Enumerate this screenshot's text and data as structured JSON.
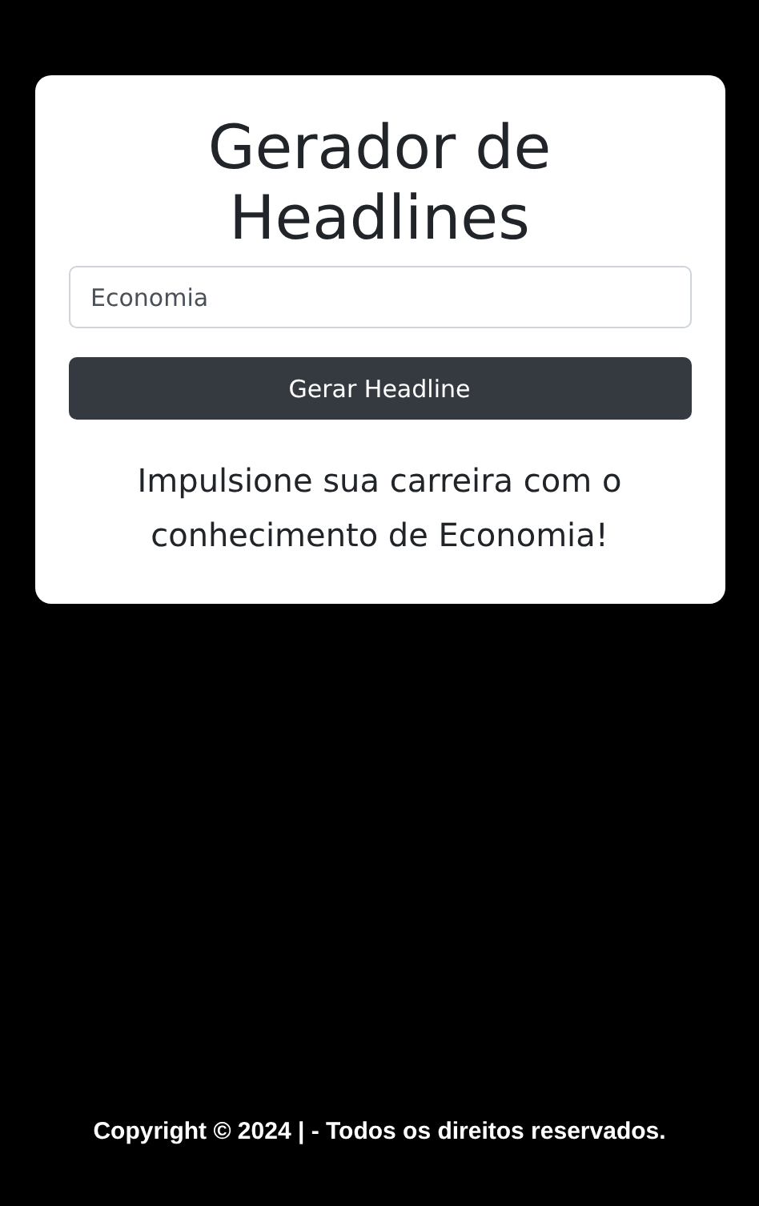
{
  "card": {
    "title": "Gerador de Headlines",
    "input": {
      "value": "Economia"
    },
    "button": "Gerar Headline",
    "result": "Impulsione sua carreira com o conhecimento de Economia!"
  },
  "footer": {
    "text": "Copyright © 2024 | - Todos os direitos reservados."
  }
}
